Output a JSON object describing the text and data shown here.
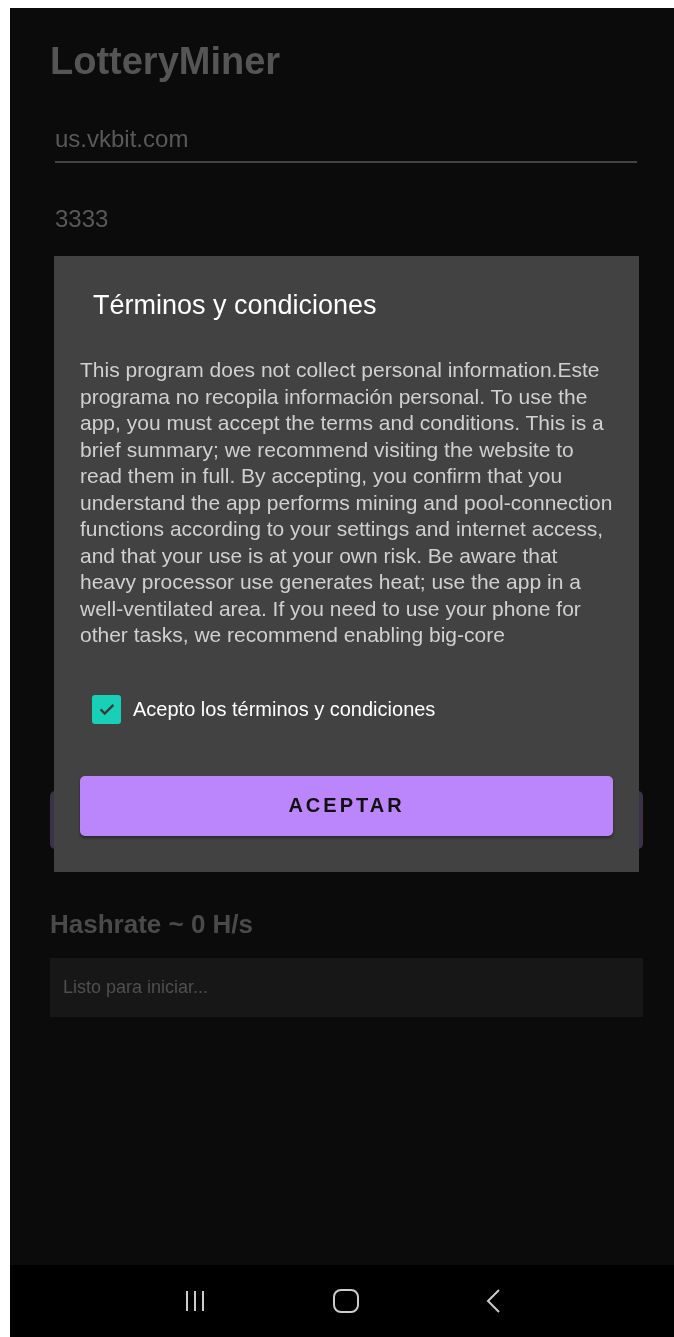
{
  "app": {
    "title": "LotteryMiner"
  },
  "fields": [
    {
      "value": "us.vkbit.com"
    },
    {
      "value": "3333"
    }
  ],
  "hashrate": "Hashrate ~ 0 H/s",
  "status": "Listo para iniciar...",
  "dialog": {
    "title": "Términos y condiciones",
    "body": "This program does not collect personal information.Este programa no recopila información personal. To use the app, you must accept the terms and conditions. This is a brief summary; we recommend visiting the website to read them in full. By accepting, you confirm that you understand the app performs mining and pool-connection functions according to your settings and internet access, and that your use is at your own risk. Be aware that heavy processor use generates heat; use the app in a well-ventilated area. If you need to use your phone for other tasks, we recommend enabling big-core",
    "checkbox": {
      "label": "Acepto los términos y condiciones",
      "checked": true
    },
    "button": "ACEPTAR"
  }
}
